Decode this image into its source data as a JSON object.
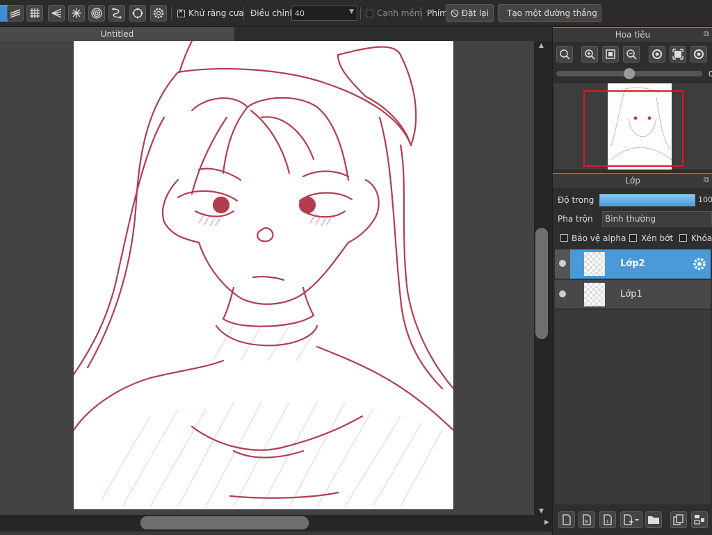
{
  "toolbar": {
    "antialias_label": "Khử răng cưa",
    "adjust_label": "Điều chỉnh",
    "adjust_value": "40",
    "soft_edge_label": "Cạnh mềm",
    "key_label": "Phím",
    "reset_label": "Đặt lại",
    "straight_line_label": "Tạo một đường thẳng"
  },
  "document": {
    "tab_title": "Untitled"
  },
  "navigator": {
    "title": "Hoa tiêu",
    "zoom_value": "0"
  },
  "layers": {
    "title": "Lớp",
    "opacity_label": "Độ trong",
    "opacity_value": "100",
    "opacity_fraction": 1.0,
    "blend_label": "Pha trộn",
    "blend_value": "Bình thường",
    "protect_alpha_label": "Bảo vệ alpha",
    "clip_label": "Xén bớt",
    "lock_label": "Khóa",
    "items": [
      {
        "name": "Lớp2",
        "selected": true
      },
      {
        "name": "Lớp1",
        "selected": false
      }
    ]
  },
  "colors": {
    "accent": "#3c8ed6",
    "line": "#b03a4e",
    "selected_layer": "#4a9ad8"
  }
}
